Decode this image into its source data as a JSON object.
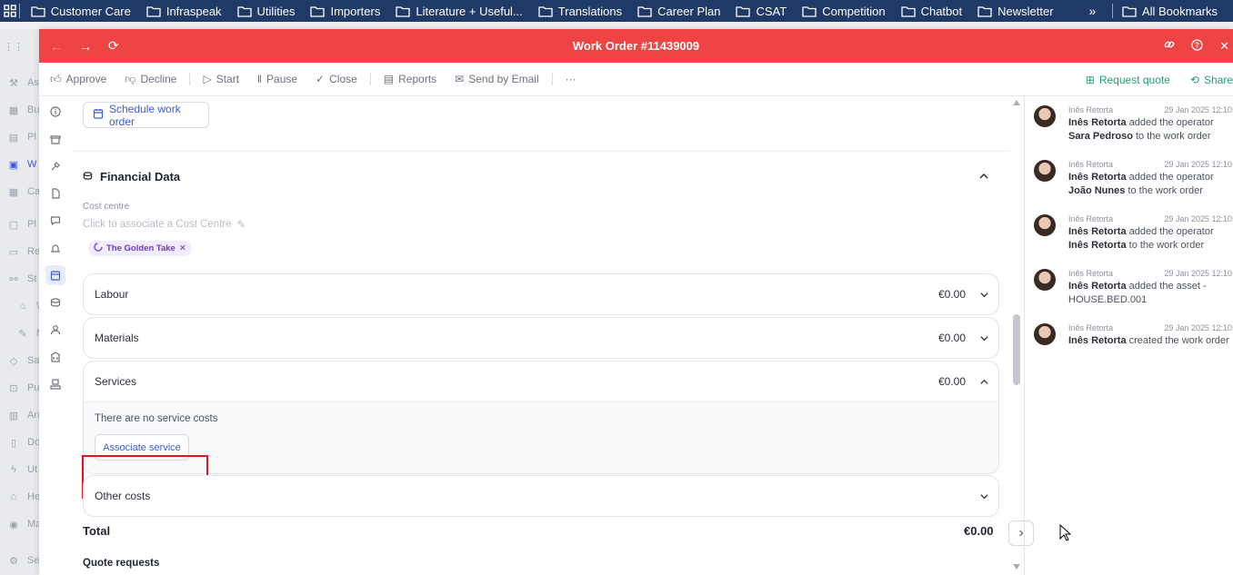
{
  "bookmarks": {
    "items": [
      "Customer Care",
      "Infraspeak",
      "Utilities",
      "Importers",
      "Literature + Useful...",
      "Translations",
      "Career Plan",
      "CSAT",
      "Competition",
      "Chatbot",
      "Newsletter"
    ],
    "all_label": "All Bookmarks"
  },
  "bg_sidebar": {
    "items": [
      "As",
      "Bu",
      "Pl",
      "W",
      "Ca",
      "Pl",
      "Re",
      "St",
      "W",
      "M",
      "Sa",
      "Pu",
      "An",
      "Do",
      "Ut",
      "He",
      "Ma",
      "Se"
    ]
  },
  "modal": {
    "title": "Work Order #11439009",
    "colors": {
      "header": "#f04343",
      "accent": "#3d5bd9",
      "green": "#22a06b",
      "highlight": "#e3141d"
    }
  },
  "toolbar": {
    "approve": "Approve",
    "decline": "Decline",
    "start": "Start",
    "pause": "Pause",
    "close": "Close",
    "reports": "Reports",
    "send_email": "Send by Email",
    "more": "···",
    "request_quote": "Request quote",
    "share": "Share"
  },
  "main": {
    "schedule_button": "Schedule work order",
    "financial_title": "Financial Data",
    "cost_centre_label": "Cost centre",
    "cost_centre_placeholder": "Click to associate a Cost Centre",
    "tag": "The Golden Take",
    "sections": [
      {
        "label": "Labour",
        "amount": "€0.00"
      },
      {
        "label": "Materials",
        "amount": "€0.00"
      },
      {
        "label": "Services",
        "amount": "€0.00"
      },
      {
        "label": "Other costs",
        "amount": ""
      }
    ],
    "no_service_costs": "There are no service costs",
    "associate_service": "Associate service",
    "total_label": "Total",
    "total_value": "€0.00",
    "quote_requests": "Quote requests"
  },
  "activity": [
    {
      "user": "Inês Retorta",
      "time": "29 Jan 2025 12:10",
      "actor": "Inês Retorta",
      "text1": "added the operator",
      "object": "Sara Pedroso",
      "text2": "to the work order"
    },
    {
      "user": "Inês Retorta",
      "time": "29 Jan 2025 12:10",
      "actor": "Inês Retorta",
      "text1": "added the operator",
      "object": "João Nunes",
      "text2": "to the work order"
    },
    {
      "user": "Inês Retorta",
      "time": "29 Jan 2025 12:10",
      "actor": "Inês Retorta",
      "text1": "added the operator",
      "object": "Inês Retorta",
      "text2": "to the work order"
    },
    {
      "user": "Inês Retorta",
      "time": "29 Jan 2025 12:10",
      "actor": "Inês Retorta",
      "text1": "added the asset -",
      "object": "",
      "text2": "HOUSE.BED.001"
    },
    {
      "user": "Inês Retorta",
      "time": "29 Jan 2025 12:10",
      "actor": "Inês Retorta",
      "text1": "created the work order",
      "object": "",
      "text2": ""
    }
  ]
}
